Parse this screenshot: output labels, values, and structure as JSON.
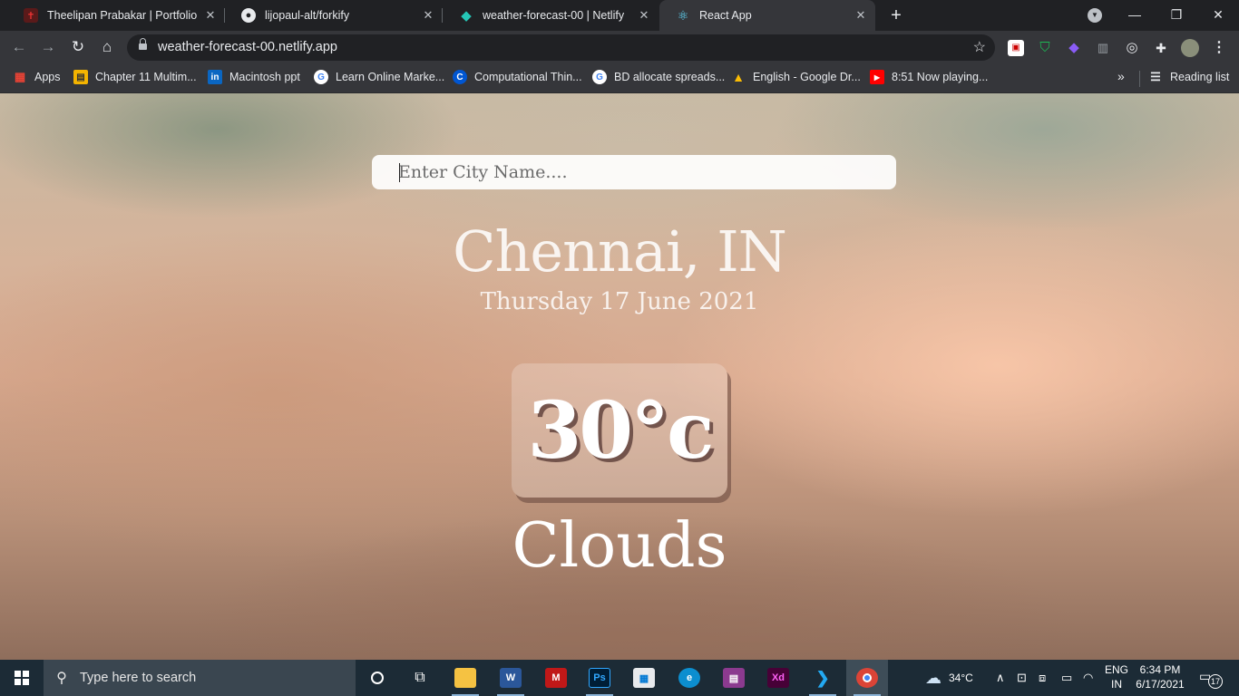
{
  "browser": {
    "tabs": [
      {
        "title": "Theelipan Prabakar | Portfolio",
        "favicon": "portfolio-icon",
        "active": false
      },
      {
        "title": "lijopaul-alt/forkify",
        "favicon": "github-icon",
        "active": false
      },
      {
        "title": "weather-forecast-00 | Netlify",
        "favicon": "netlify-icon",
        "active": false
      },
      {
        "title": "React App",
        "favicon": "react-icon",
        "active": true
      }
    ],
    "address": "weather-forecast-00.netlify.app",
    "bookmarks": [
      {
        "label": "Apps",
        "icon": "apps-grid-icon"
      },
      {
        "label": "Chapter 11 Multim...",
        "icon": "bookmark-page-icon"
      },
      {
        "label": "Macintosh ppt",
        "icon": "linkedin-icon"
      },
      {
        "label": "Learn Online Marke...",
        "icon": "google-icon"
      },
      {
        "label": "Computational Thin...",
        "icon": "coursera-icon"
      },
      {
        "label": "BD allocate spreads...",
        "icon": "google-icon"
      },
      {
        "label": "English - Google Dr...",
        "icon": "google-drive-icon"
      },
      {
        "label": "8:51 Now playing...",
        "icon": "youtube-icon"
      }
    ],
    "reading_list": "Reading list"
  },
  "app": {
    "search_placeholder": "Enter City Name....",
    "city": "Chennai, IN",
    "date": "Thursday 17 June 2021",
    "temperature": "30°c",
    "condition": "Clouds"
  },
  "taskbar": {
    "search_placeholder": "Type here to search",
    "weather": "34°C",
    "lang_1": "ENG",
    "lang_2": "IN",
    "time": "6:34 PM",
    "date": "6/17/2021",
    "notifications": "17"
  },
  "colors": {
    "chrome_dark": "#202124",
    "chrome_toolbar": "#35363a",
    "taskbar": "#1c2b36"
  }
}
